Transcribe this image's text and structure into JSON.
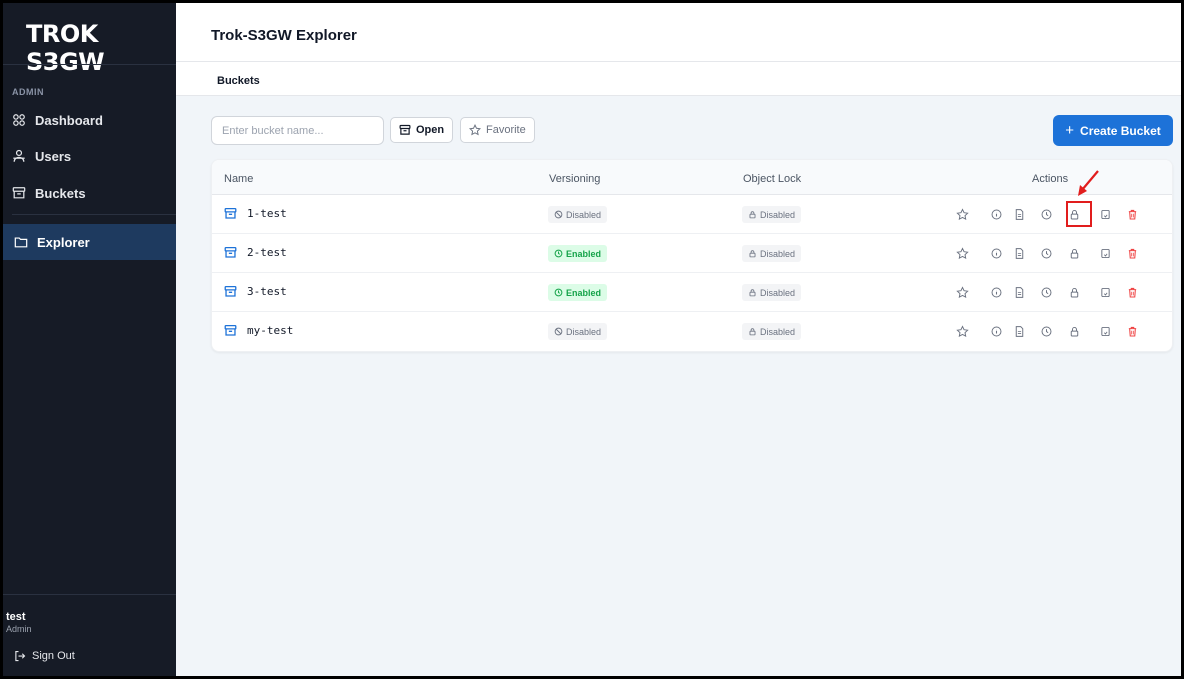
{
  "sidebar": {
    "brand": "TROK S3GW",
    "section_label": "ADMIN",
    "items": [
      {
        "label": "Dashboard",
        "icon": "dashboard-icon"
      },
      {
        "label": "Users",
        "icon": "users-icon"
      },
      {
        "label": "Buckets",
        "icon": "bucket-icon"
      }
    ],
    "active_item": {
      "label": "Explorer",
      "icon": "folder-icon"
    },
    "user": {
      "name": "test",
      "role": "Admin"
    },
    "sign_out": "Sign Out"
  },
  "header": {
    "title": "Trok-S3GW Explorer",
    "breadcrumb": "Buckets"
  },
  "toolbar": {
    "search_placeholder": "Enter bucket name...",
    "open_label": "Open",
    "favorite_label": "Favorite",
    "create_label": "Create Bucket"
  },
  "table": {
    "columns": {
      "name": "Name",
      "versioning": "Versioning",
      "object_lock": "Object Lock",
      "actions": "Actions"
    },
    "rows": [
      {
        "name": "1-test",
        "versioning": "Disabled",
        "versioning_enabled": false,
        "object_lock": "Disabled"
      },
      {
        "name": "2-test",
        "versioning": "Enabled",
        "versioning_enabled": true,
        "object_lock": "Disabled"
      },
      {
        "name": "3-test",
        "versioning": "Enabled",
        "versioning_enabled": true,
        "object_lock": "Disabled"
      },
      {
        "name": "my-test",
        "versioning": "Disabled",
        "versioning_enabled": false,
        "object_lock": "Disabled"
      }
    ],
    "action_icons": [
      "star-icon",
      "info-icon",
      "document-icon",
      "clock-icon",
      "lock-icon",
      "copy-icon",
      "trash-icon"
    ]
  },
  "colors": {
    "sidebar_bg": "#161b26",
    "active_nav_bg": "#1e3a5f",
    "accent": "#1d72d8",
    "enabled_green": "#16a34a",
    "delete_red": "#ef4444",
    "highlight_red": "#e11d1d"
  }
}
